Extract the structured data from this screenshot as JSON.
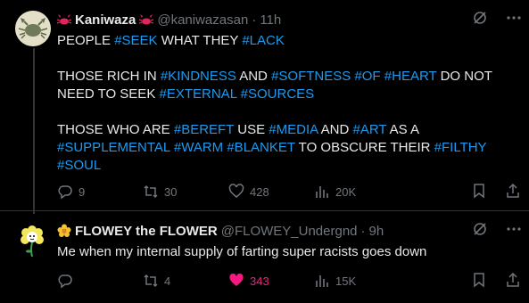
{
  "tweet1": {
    "display_name": "Kaniwaza",
    "handle": "@kaniwazasan",
    "separator": "·",
    "time": "11h",
    "paragraphs": [
      [
        {
          "t": "PEOPLE ",
          "tag": false
        },
        {
          "t": "#SEEK",
          "tag": true
        },
        {
          "t": " WHAT THEY ",
          "tag": false
        },
        {
          "t": "#LACK",
          "tag": true
        }
      ],
      [
        {
          "t": "THOSE RICH IN ",
          "tag": false
        },
        {
          "t": "#KINDNESS",
          "tag": true
        },
        {
          "t": " AND ",
          "tag": false
        },
        {
          "t": "#SOFTNESS",
          "tag": true
        },
        {
          "t": " ",
          "tag": false
        },
        {
          "t": "#OF",
          "tag": true
        },
        {
          "t": " ",
          "tag": false
        },
        {
          "t": "#HEART",
          "tag": true
        },
        {
          "t": " DO NOT NEED TO SEEK ",
          "tag": false
        },
        {
          "t": "#EXTERNAL",
          "tag": true
        },
        {
          "t": " ",
          "tag": false
        },
        {
          "t": "#SOURCES",
          "tag": true
        }
      ],
      [
        {
          "t": "THOSE WHO ARE ",
          "tag": false
        },
        {
          "t": "#BEREFT",
          "tag": true
        },
        {
          "t": " USE ",
          "tag": false
        },
        {
          "t": "#MEDIA",
          "tag": true
        },
        {
          "t": " AND ",
          "tag": false
        },
        {
          "t": "#ART",
          "tag": true
        },
        {
          "t": " AS A ",
          "tag": false
        },
        {
          "t": "#SUPPLEMENTAL",
          "tag": true
        },
        {
          "t": " ",
          "tag": false
        },
        {
          "t": "#WARM",
          "tag": true
        },
        {
          "t": " ",
          "tag": false
        },
        {
          "t": "#BLANKET",
          "tag": true
        },
        {
          "t": " TO OBSCURE THEIR ",
          "tag": false
        },
        {
          "t": "#FILTHY",
          "tag": true
        },
        {
          "t": " ",
          "tag": false
        },
        {
          "t": "#SOUL",
          "tag": true
        }
      ]
    ],
    "stats": {
      "replies": "9",
      "reposts": "30",
      "likes": "428",
      "views": "20K"
    }
  },
  "tweet2": {
    "display_name": "FLOWEY the FLOWER",
    "handle": "@FLOWEY_Undergnd",
    "separator": "·",
    "time": "9h",
    "text": "Me when my internal supply of farting super racists goes down",
    "stats": {
      "replies": "",
      "reposts": "4",
      "likes": "343",
      "views": "15K"
    }
  },
  "colors": {
    "accent": "#1d9bf0",
    "muted": "#71767b",
    "like": "#f91880",
    "background": "#000000"
  },
  "icons": [
    "crab-icon",
    "flower-icon",
    "grok-icon",
    "more-icon",
    "reply-icon",
    "repost-icon",
    "like-icon",
    "views-icon",
    "bookmark-icon",
    "share-icon"
  ]
}
